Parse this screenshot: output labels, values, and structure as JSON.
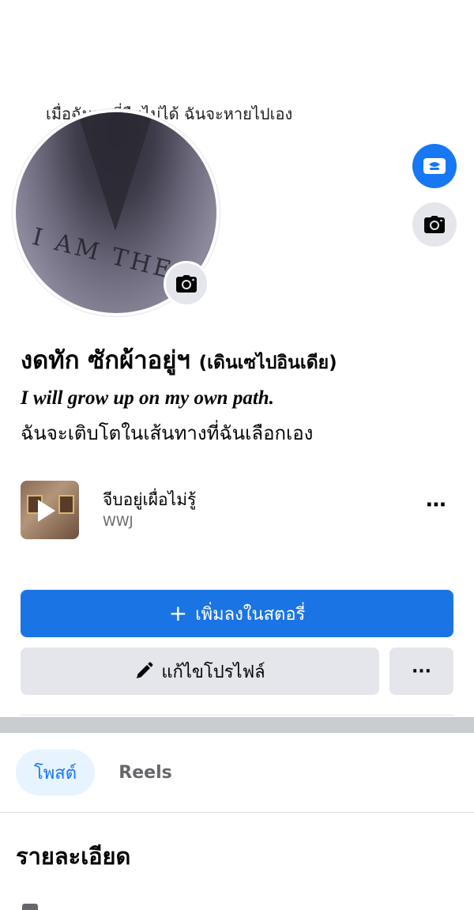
{
  "cover": {
    "caption": "เมื่อฉันหาที่ยืนไม่ได้ ฉันจะหายไปเอง"
  },
  "profile": {
    "name": "งดทัก ซักผ้าอยู่ฯ",
    "alt_name": "(เดินเซไปอินเดีย)",
    "bio_line1": "I will grow up on my own path.",
    "bio_line2": "ฉันจะเติบโตในเส้นทางที่ฉันเลือกเอง",
    "avatar_print_text": "I AM THEDY"
  },
  "music": {
    "title": "จีบอยู่เผื่อไม่รู้",
    "artist": "WWJ",
    "more_icon": "⋯"
  },
  "actions": {
    "add_story_label": "เพิ่มลงในสตอรี่",
    "add_story_icon": "+",
    "edit_profile_label": "แก้ไขโปรไฟล์",
    "more_label": "···"
  },
  "tabs": {
    "items": [
      {
        "label": "โพสต์",
        "active": true
      },
      {
        "label": "Reels",
        "active": false
      }
    ]
  },
  "details": {
    "title": "รายละเอียด"
  },
  "icons": {
    "avatar_camera": "camera-icon",
    "cover_camera": "camera-icon",
    "avatar_frame": "avatar-frame-icon",
    "edit": "pencil-icon",
    "play": "play-icon"
  },
  "colors": {
    "primary_blue": "#1b74e4",
    "light_gray": "#e4e6eb",
    "active_tab_bg": "#e7f3ff",
    "secondary_text": "#65676b",
    "separator": "#c9ccd1"
  }
}
